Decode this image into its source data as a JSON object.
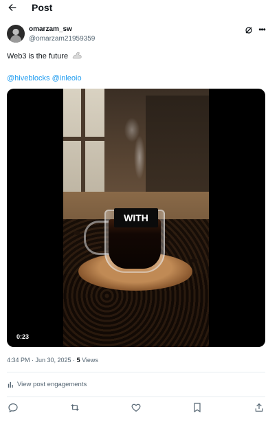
{
  "header": {
    "title": "Post"
  },
  "author": {
    "name": "omarzam_sw",
    "handle": "@omarzam21959359"
  },
  "post": {
    "text": "Web3 is the future",
    "text_emoji": "flexed-biceps-icon",
    "mention_1": "@hiveblocks",
    "mention_2": "@inleoio"
  },
  "media": {
    "caption": "WITH",
    "duration": "0:23"
  },
  "meta": {
    "time_date": "4:34 PM · Jun 30, 2025 · ",
    "views_count": "5",
    "views_label": " Views"
  },
  "engagements": {
    "label": "View post engagements"
  },
  "colors": {
    "link": "#1d9bf0",
    "muted": "#536471",
    "text": "#0f1419"
  }
}
